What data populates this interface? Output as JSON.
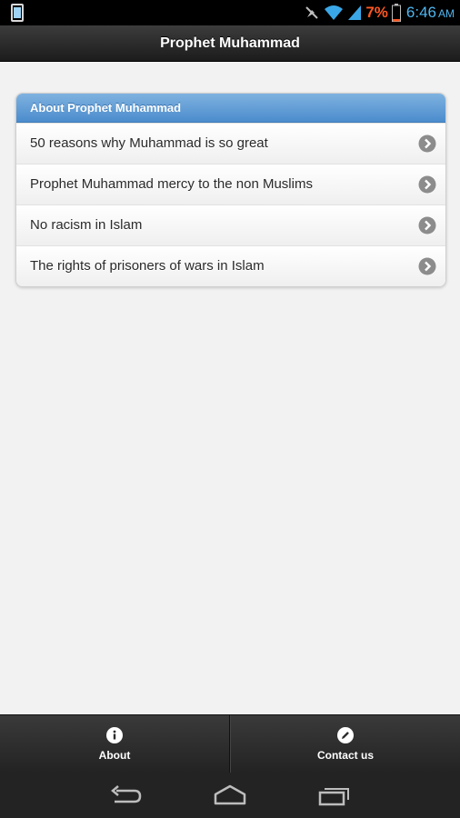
{
  "status_bar": {
    "battery_percent": "7%",
    "time": "6:46",
    "ampm": "AM"
  },
  "header": {
    "title": "Prophet Muhammad"
  },
  "list": {
    "divider_label": "About Prophet Muhammad",
    "items": [
      {
        "label": "50 reasons why Muhammad is so great"
      },
      {
        "label": "Prophet Muhammad mercy to the non Muslims"
      },
      {
        "label": "No racism in Islam"
      },
      {
        "label": "The rights of prisoners of wars in Islam"
      }
    ]
  },
  "footer": {
    "tabs": [
      {
        "label": "About",
        "icon": "info-icon"
      },
      {
        "label": "Contact us",
        "icon": "pencil-icon"
      }
    ]
  },
  "colors": {
    "accent_blue": "#4b8ccd",
    "battery_low": "#ff5722",
    "clock": "#4fb6f0"
  }
}
